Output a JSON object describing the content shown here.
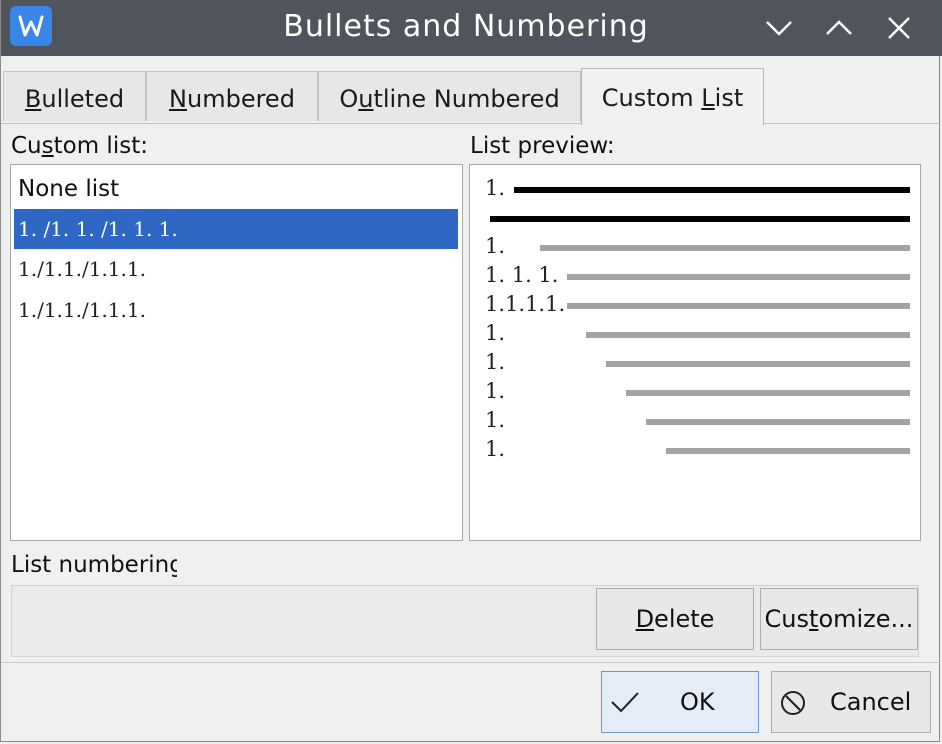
{
  "window": {
    "title": "Bullets and Numbering",
    "app_icon_letter": "W",
    "accent": "#3a86e8",
    "titlebar_color": "#50555c"
  },
  "tabs": [
    {
      "pre": "",
      "u": "B",
      "post": "ulleted"
    },
    {
      "pre": "",
      "u": "N",
      "post": "umbered"
    },
    {
      "pre": "O",
      "u": "u",
      "post": "tline Numbered"
    },
    {
      "pre": "Custom ",
      "u": "L",
      "post": "ist"
    }
  ],
  "custom_list": {
    "label_pre": "Cu",
    "label_u": "s",
    "label_post": "tom list:",
    "items": [
      "None list",
      "1. /1. 1. /1. 1. 1.",
      "1./1.1./1.1.1.",
      "1./1.1./1.1.1."
    ],
    "selected_index": 1,
    "selection_color": "#2f68c4"
  },
  "preview": {
    "label": "List preview:",
    "rows": [
      {
        "num": "1.",
        "kind": "dark"
      },
      {
        "num": "",
        "kind": "dark"
      },
      {
        "num": "1.",
        "kind": "gray"
      },
      {
        "num": "1. 1. 1.",
        "kind": "gray"
      },
      {
        "num": "1.1.1.1.",
        "kind": "gray"
      },
      {
        "num": "1.",
        "kind": "gray"
      },
      {
        "num": "1.",
        "kind": "gray"
      },
      {
        "num": "1.",
        "kind": "gray"
      },
      {
        "num": "1.",
        "kind": "gray"
      },
      {
        "num": "1.",
        "kind": "gray"
      }
    ],
    "dark_color": "#000000",
    "gray_color": "#a3a3a3"
  },
  "list_numbering": {
    "label": "List numbering"
  },
  "buttons": {
    "delete": {
      "u": "D",
      "post": "elete"
    },
    "customize": {
      "pre": "Cus",
      "u": "t",
      "post": "omize..."
    },
    "ok": "OK",
    "cancel": "Cancel"
  }
}
